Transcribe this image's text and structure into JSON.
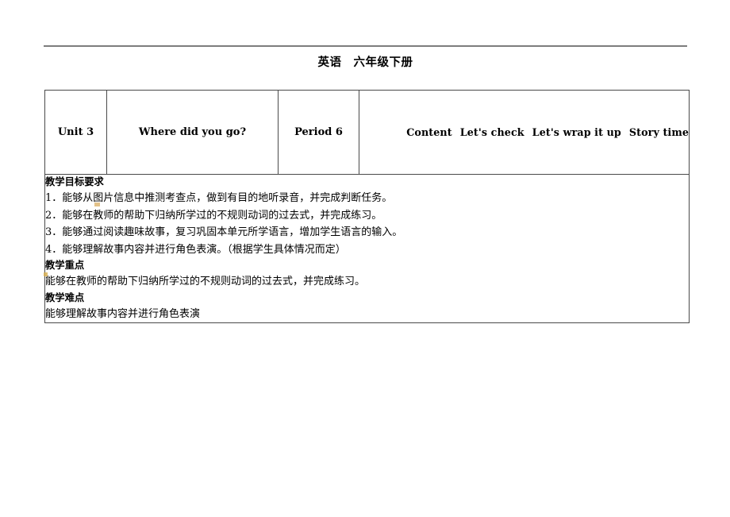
{
  "document": {
    "title": "英语　六年级下册"
  },
  "table": {
    "header": {
      "unit": "Unit 3",
      "lesson_title": "Where did you go?",
      "period": "Period 6",
      "content_items": [
        "Content",
        "Let's check",
        "Let's wrap it up",
        "Story time"
      ]
    },
    "body": {
      "objectives_heading": "教学目标要求",
      "objectives": [
        "1．能够从图片信息中推测考查点，做到有目的地听录音，并完成判断任务。",
        "2．能够在教师的帮助下归纳所学过的不规则动词的过去式，并完成练习。",
        "3．能够通过阅读趣味故事，复习巩固本单元所学语言，增加学生语言的输入。",
        "4．能够理解故事内容并进行角色表演。（根据学生具体情况而定）"
      ],
      "key_points_heading": "教学重点",
      "key_points_text": "能够在教师的帮助下归纳所学过的不规则动词的过去式，并完成练习。",
      "difficult_points_heading": "教学难点",
      "difficult_points_text": "能够理解故事内容并进行角色表演"
    }
  },
  "colors": {
    "rule": "#7d7d7d",
    "table_border": "#4a4a4a",
    "highlight_mark": "#d9ae62",
    "text": "#000000"
  }
}
